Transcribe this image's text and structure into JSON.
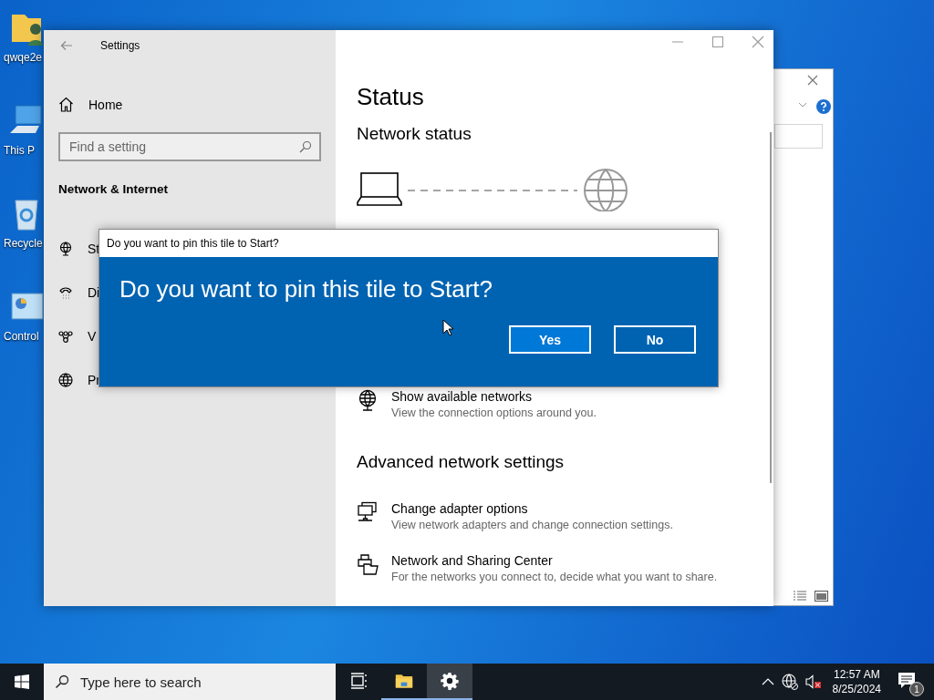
{
  "desktop_icons": [
    {
      "label": "qwqe2e",
      "kind": "user-folder"
    },
    {
      "label": "This P",
      "kind": "computer"
    },
    {
      "label": "Recycle",
      "kind": "recycle-bin"
    },
    {
      "label": "Control",
      "kind": "control-panel"
    }
  ],
  "settings": {
    "title": "Settings",
    "home": "Home",
    "search": {
      "placeholder": "Find a setting"
    },
    "section": "Network & Internet",
    "nav": [
      {
        "label": "St",
        "kind": "status"
      },
      {
        "label": "Di",
        "kind": "dialup"
      },
      {
        "label": "V",
        "kind": "vpn"
      },
      {
        "label": "Pr",
        "kind": "proxy"
      }
    ],
    "page_title": "Status",
    "heading": "Network status",
    "links": [
      {
        "title": "Show available networks",
        "description": "View the connection options around you.",
        "kind": "networks"
      }
    ],
    "advanced_heading": "Advanced network settings",
    "advanced_links": [
      {
        "title": "Change adapter options",
        "description": "View network adapters and change connection settings.",
        "kind": "adapter"
      },
      {
        "title": "Network and Sharing Center",
        "description": "For the networks you connect to, decide what you want to share.",
        "kind": "sharing"
      }
    ]
  },
  "dialog": {
    "title": "Do you want to pin this tile to Start?",
    "message": "Do you want to pin this tile to Start?",
    "buttons": [
      {
        "label": "Yes",
        "focused": true
      },
      {
        "label": "No",
        "focused": false
      }
    ]
  },
  "taskbar": {
    "search_placeholder": "Type here to search",
    "apps": [
      {
        "kind": "task-view",
        "running": false,
        "active": false
      },
      {
        "kind": "explorer",
        "running": true,
        "active": false
      },
      {
        "kind": "settings",
        "running": true,
        "active": true
      }
    ],
    "time": "12:57 AM",
    "date": "8/25/2024",
    "notifications": "1"
  }
}
